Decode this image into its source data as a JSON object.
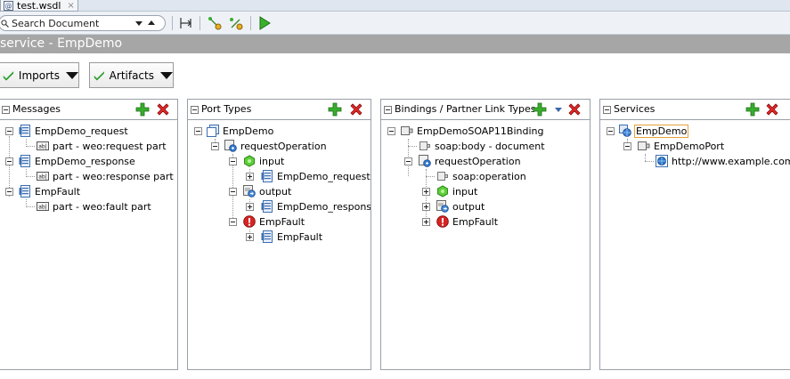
{
  "tab": {
    "label": "test.wsdl",
    "close": "×"
  },
  "search": {
    "text": "Search Document"
  },
  "service_title": "service - EmpDemo",
  "buttons": {
    "imports": "Imports",
    "artifacts": "Artifacts"
  },
  "panels": {
    "messages": {
      "title": "Messages",
      "nodes": [
        "EmpDemo_request",
        "part - weo:request part",
        "EmpDemo_response",
        "part - weo:response part",
        "EmpFault",
        "part - weo:fault part"
      ]
    },
    "port_types": {
      "title": "Port Types",
      "nodes": [
        "EmpDemo",
        "requestOperation",
        "input",
        "EmpDemo_request",
        "output",
        "EmpDemo_response",
        "EmpFault",
        "EmpFault"
      ]
    },
    "bindings": {
      "title": "Bindings / Partner Link Types",
      "nodes": [
        "EmpDemoSOAP11Binding",
        "soap:body - document",
        "requestOperation",
        "soap:operation",
        "input",
        "output",
        "EmpFault"
      ]
    },
    "services": {
      "title": "Services",
      "nodes": [
        "EmpDemo",
        "EmpDemoPort",
        "http://www.example.com"
      ]
    }
  },
  "colors": {
    "header_bar": "#a6a6a6",
    "add": "#2e9b2e",
    "delete": "#d42020",
    "accent_blue": "#3a6aa8"
  }
}
